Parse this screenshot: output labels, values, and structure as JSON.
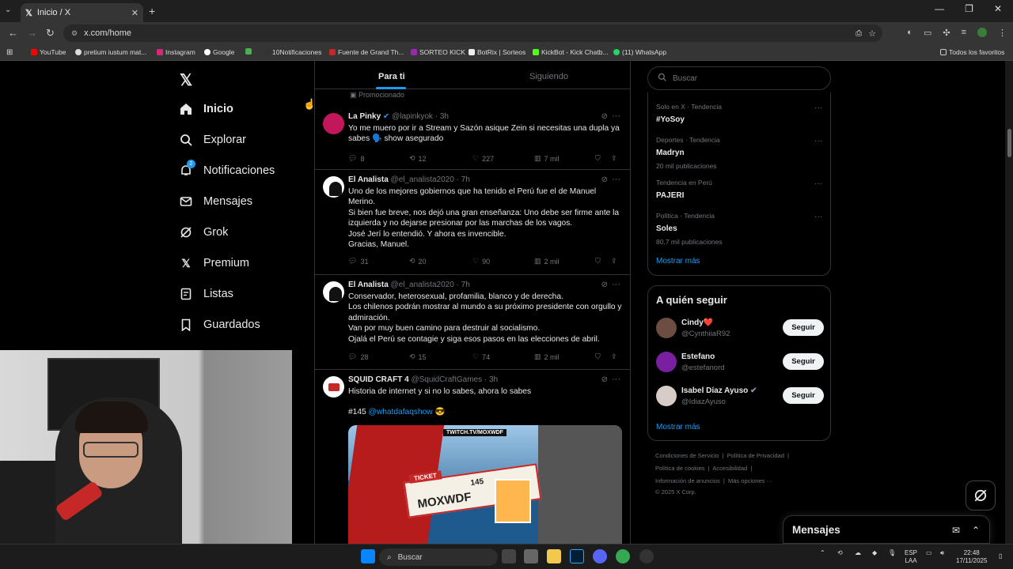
{
  "browser": {
    "tab_title": "Inicio / X",
    "url": "x.com/home",
    "bookmarks": [
      "YouTube",
      "pretium iustum mat...",
      "Instagram",
      "Google",
      "10Notificaciones",
      "Fuente de Grand Th...",
      "SORTEO KICK",
      "BotRix | Sorteos",
      "KickBot - Kick Chatb...",
      "(11) WhatsApp"
    ],
    "all_bookmarks": "Todos los favoritos"
  },
  "nav": {
    "items": [
      {
        "label": "Inicio",
        "icon": "home-icon"
      },
      {
        "label": "Explorar",
        "icon": "search-icon"
      },
      {
        "label": "Notificaciones",
        "icon": "bell-icon",
        "badge": "2"
      },
      {
        "label": "Mensajes",
        "icon": "mail-icon"
      },
      {
        "label": "Grok",
        "icon": "grok-icon"
      },
      {
        "label": "Premium",
        "icon": "x-logo-icon"
      },
      {
        "label": "Listas",
        "icon": "list-icon"
      },
      {
        "label": "Guardados",
        "icon": "bookmark-icon"
      }
    ]
  },
  "feed": {
    "tabs": [
      "Para ti",
      "Siguiendo"
    ],
    "promoted": "Promocionado",
    "tweets": [
      {
        "name": "La Pinky",
        "handle": "@lapinkyok · 3h",
        "text": [
          "Yo me muero por ir a Stream y Sazón asique Zein si necesitas una dupla ya sabes 🗣️ show asegurado"
        ],
        "replies": "8",
        "retweets": "12",
        "likes": "227",
        "views": "7 mil"
      },
      {
        "name": "El Analista",
        "handle": "@el_analista2020 · 7h",
        "text": [
          "Uno de los mejores gobiernos que ha tenido el Perú fue el de Manuel Merino.",
          "Si bien fue breve, nos dejó una gran enseñanza: Uno debe ser firme ante la izquierda y no dejarse presionar por las marchas de los vagos.",
          "José Jerí lo entendió. Y ahora es invencible.",
          "Gracias, Manuel."
        ],
        "replies": "31",
        "retweets": "20",
        "likes": "90",
        "views": "2 mil"
      },
      {
        "name": "El Analista",
        "handle": "@el_analista2020 · 7h",
        "text": [
          "Conservador, heterosexual, profamilia, blanco y de derecha.",
          "Los chilenos podrán mostrar al mundo a su próximo presidente con orgullo y admiración.",
          "Van por muy buen camino para destruir al socialismo.",
          "Ojalá el Perú se contagie y siga esos pasos en las elecciones de abril."
        ],
        "replies": "28",
        "retweets": "15",
        "likes": "74",
        "views": "2 mil"
      },
      {
        "name": "SQUID CRAFT 4",
        "handle": "@SquidCraftGames · 3h",
        "text": [
          "Historia de internet y si no lo sabes, ahora lo sabes"
        ],
        "tag": "#145",
        "mention": "@whatdafaqshow",
        "emoji": "😎"
      }
    ],
    "media": {
      "source": "TWITCH.TV/MOXWDF",
      "ticket": "TICKET",
      "number": "145",
      "name": "MOXWDF"
    }
  },
  "sidebar": {
    "search_placeholder": "Buscar",
    "trends": [
      {
        "context": "Solo en X · Tendencia",
        "title": "#YoSoy",
        "count": ""
      },
      {
        "context": "Deportes · Tendencia",
        "title": "Madryn",
        "count": "20 mil publicaciones"
      },
      {
        "context": "Tendencia en Perú",
        "title": "PAJERI",
        "count": ""
      },
      {
        "context": "Política · Tendencia",
        "title": "Soles",
        "count": "80,7 mil publicaciones"
      }
    ],
    "show_more": "Mostrar más",
    "who_to_follow_title": "A quién seguir",
    "people": [
      {
        "name": "Cindy❤️",
        "handle": "@CynthiiaR92",
        "button": "Seguir"
      },
      {
        "name": "Estefano",
        "handle": "@estefanord",
        "button": "Seguir"
      },
      {
        "name": "Isabel Díaz Ayuso",
        "handle": "@IdiazAyuso",
        "button": "Seguir"
      }
    ],
    "footer": [
      "Condiciones de Servicio",
      "Política de Privacidad",
      "Política de cookies",
      "Accesibilidad",
      "Información de anuncios",
      "Más opciones ···",
      "© 2025 X Corp."
    ]
  },
  "messages_dock": {
    "title": "Mensajes"
  },
  "taskbar": {
    "search": "Buscar",
    "lang": "ESP",
    "region": "LAA",
    "time": "22:48",
    "date": "17/11/2025"
  },
  "colors": {
    "accent": "#1d9bf0",
    "background": "#000000",
    "border": "#2f3336",
    "muted": "#71767b"
  }
}
